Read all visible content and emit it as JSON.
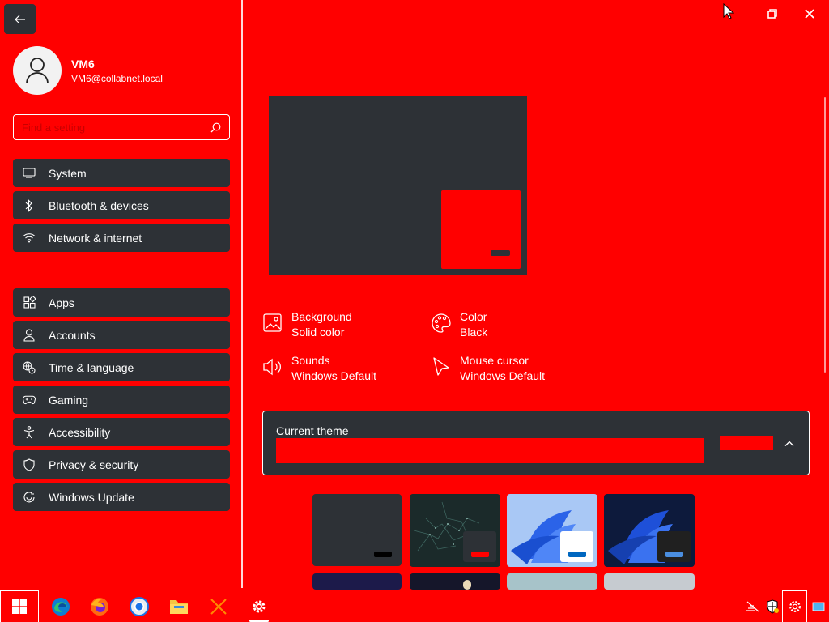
{
  "window": {
    "back_label": "←",
    "cursor_icon": "pointer-arrow-icon",
    "restore_icon": "restore-icon",
    "close_icon": "close-icon"
  },
  "user": {
    "name": "VM6",
    "email": "VM6@collabnet.local"
  },
  "search": {
    "placeholder": "Find a setting"
  },
  "sidebar": {
    "items": [
      {
        "label": "System",
        "icon": "monitor-icon"
      },
      {
        "label": "Bluetooth & devices",
        "icon": "bluetooth-icon"
      },
      {
        "label": "Network & internet",
        "icon": "wifi-icon"
      },
      {
        "label": "Apps",
        "icon": "apps-icon"
      },
      {
        "label": "Accounts",
        "icon": "person-icon"
      },
      {
        "label": "Time & language",
        "icon": "globe-clock-icon"
      },
      {
        "label": "Gaming",
        "icon": "gamepad-icon"
      },
      {
        "label": "Accessibility",
        "icon": "accessibility-icon"
      },
      {
        "label": "Privacy & security",
        "icon": "shield-icon"
      },
      {
        "label": "Windows Update",
        "icon": "update-icon"
      }
    ]
  },
  "theme_props": {
    "background": {
      "title": "Background",
      "value": "Solid color",
      "icon": "image-icon"
    },
    "color": {
      "title": "Color",
      "value": "Black",
      "icon": "palette-icon"
    },
    "sounds": {
      "title": "Sounds",
      "value": "Windows Default",
      "icon": "speaker-icon"
    },
    "cursor": {
      "title": "Mouse cursor",
      "value": "Windows Default",
      "icon": "cursor-icon"
    }
  },
  "current_theme": {
    "label": "Current theme"
  },
  "themes": [
    {
      "name": "dark-solid",
      "bg": "#2d3136",
      "mini_bg": "#2d3136",
      "bar": "#000000"
    },
    {
      "name": "glow",
      "bg": "#1b2a2a",
      "mini_bg": "#2d3136",
      "bar": "#ff0000"
    },
    {
      "name": "windows-light",
      "bg": "#8fb8f2",
      "mini_bg": "#ffffff",
      "bar": "#0067c0"
    },
    {
      "name": "windows-dark",
      "bg": "#0d1a3c",
      "mini_bg": "#202020",
      "bar": "#4a8ee0"
    }
  ],
  "taskbar": {
    "apps": [
      "windows-start-icon",
      "edge-icon",
      "firefox-icon",
      "chrome-icon",
      "file-explorer-icon",
      "x-app-icon",
      "settings-gear-icon"
    ],
    "tray": [
      "network-off-icon",
      "security-shield-icon",
      "settings-tray-icon",
      "notification-icon"
    ]
  },
  "colors": {
    "accent": "#ff0000",
    "surface": "#2d3136",
    "text": "#ffffff"
  }
}
